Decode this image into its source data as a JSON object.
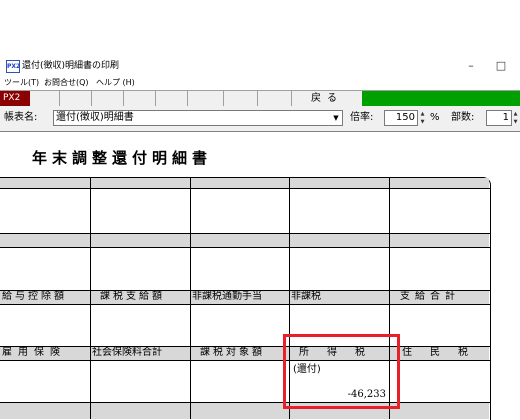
{
  "window": {
    "app_icon_text": "PX2",
    "title": "還付(徴収)明細書の印刷",
    "minimize_glyph": "–",
    "maximize_glyph": "□"
  },
  "menu": {
    "items": [
      "ツール(T)",
      "お問合せ(Q)",
      "ヘルプ (H)"
    ]
  },
  "toolbar": {
    "px2_label": "PX2",
    "back_label": "戻る"
  },
  "form": {
    "report_name_label": "帳表名:",
    "report_name_value": "還付(徴収)明細書",
    "zoom_label": "倍率:",
    "zoom_value": "150",
    "zoom_unit": "%",
    "copies_label": "部数:",
    "copies_value": "1"
  },
  "document": {
    "title": "年末調整還付明細書",
    "row1_headers": [
      "給与控除額",
      "課税支給額",
      "非課税通勤手当",
      "非課税",
      "支給合計"
    ],
    "row2_headers": [
      "雇用保険",
      "社会保険料合計",
      "課税対象額",
      "所得税",
      "住民税"
    ],
    "income_tax_sub_label": "(還付)",
    "income_tax_amount": "-46,233"
  },
  "colors": {
    "highlight": "#e8202a",
    "toolbar_green": "#00a000",
    "px2_badge": "#8b0000"
  }
}
